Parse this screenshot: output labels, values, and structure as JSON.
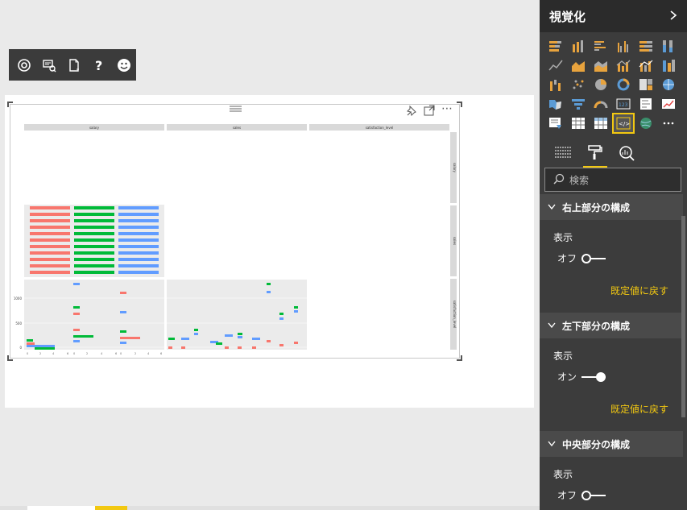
{
  "pane": {
    "title": "視覚化",
    "search_placeholder": "検索",
    "sections": [
      {
        "title": "右上部分の構成",
        "display_label": "表示",
        "toggle_state": "オフ",
        "toggle_on": false,
        "reset_label": "既定値に戻す"
      },
      {
        "title": "左下部分の構成",
        "display_label": "表示",
        "toggle_state": "オン",
        "toggle_on": true,
        "reset_label": "既定値に戻す"
      },
      {
        "title": "中央部分の構成",
        "display_label": "表示",
        "toggle_state": "オフ",
        "toggle_on": false
      }
    ]
  },
  "visual": {
    "facet_cols": [
      "salary",
      "sales",
      "satisfaction_level"
    ],
    "facet_rows": [
      "salary",
      "sales",
      "satisfaction_level"
    ],
    "y_ticks": [
      "1000",
      "500",
      "0"
    ]
  },
  "colors": {
    "red": "#f8766d",
    "green": "#00ba38",
    "blue": "#619cff",
    "accent": "#f2c811"
  }
}
